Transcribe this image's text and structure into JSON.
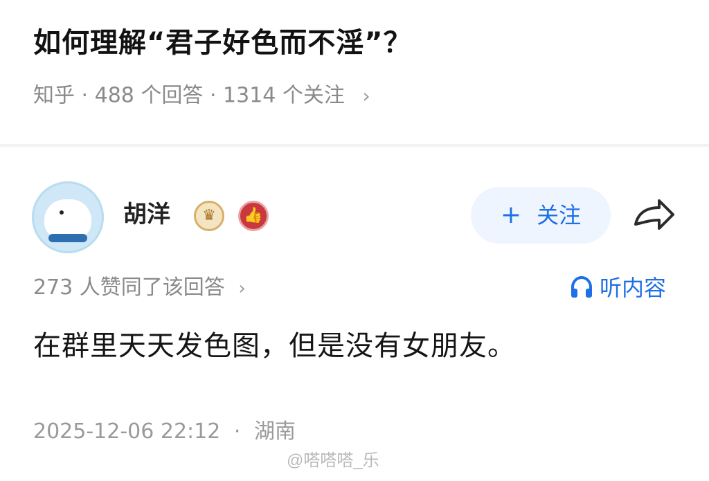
{
  "question": {
    "title": "如何理解“君子好色而不淫”？",
    "source": "知乎",
    "answers_count": "488 个回答",
    "followers_count": "1314 个关注"
  },
  "author": {
    "name": "胡洋",
    "avatar_icon": "polar-bear-avatar",
    "badges": [
      "crown-badge-icon",
      "thumbs-up-badge-icon"
    ],
    "follow_label": "关注",
    "share_icon": "share-arrow-icon"
  },
  "answer": {
    "likes_text": "273 人赞同了该回答",
    "listen_label": "听内容",
    "text": "在群里天天发色图，但是没有女朋友。",
    "date": "2025-12-06 22:12",
    "location": "湖南"
  },
  "watermark": {
    "text": "@嗒嗒嗒_乐"
  },
  "colors": {
    "accent": "#1f6fe6",
    "follow_bg": "#eef5ff",
    "muted_text": "#8a8a8a",
    "divider": "#f2f2f2"
  }
}
